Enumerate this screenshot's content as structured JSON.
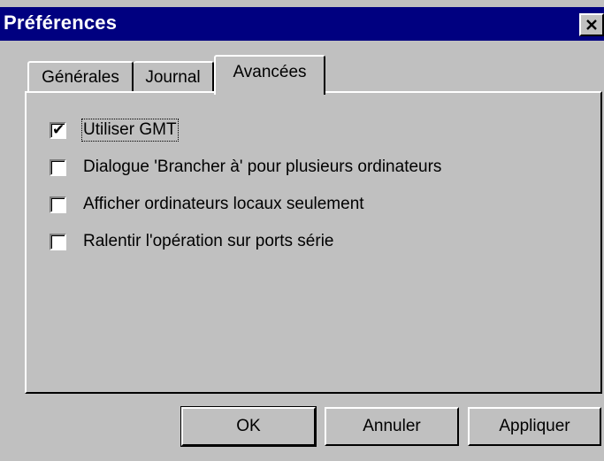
{
  "window": {
    "title": "Préférences",
    "close_icon": "close-icon"
  },
  "tabs": [
    {
      "label": "Générales",
      "selected": false
    },
    {
      "label": "Journal",
      "selected": false
    },
    {
      "label": "Avancées",
      "selected": true
    }
  ],
  "options": [
    {
      "label": "Utiliser GMT",
      "checked": true
    },
    {
      "label": "Dialogue 'Brancher à' pour plusieurs ordinateurs",
      "checked": false
    },
    {
      "label": "Afficher ordinateurs locaux seulement",
      "checked": false
    },
    {
      "label": "Ralentir l'opération sur ports série",
      "checked": false
    }
  ],
  "buttons": {
    "ok": "OK",
    "cancel": "Annuler",
    "apply": "Appliquer"
  },
  "colors": {
    "titlebar": "#000080",
    "face": "#c0c0c0"
  }
}
